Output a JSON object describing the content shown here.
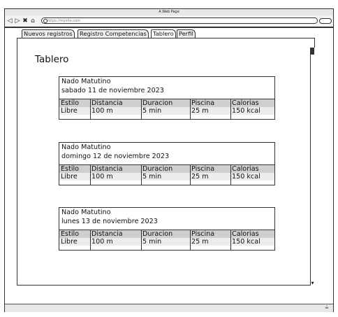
{
  "browser": {
    "window_title": "A Web Page",
    "url": "https://mysite.com"
  },
  "tabs": [
    {
      "label": "Nuevos registros"
    },
    {
      "label": "Registro Competencias"
    },
    {
      "label": "Tablero"
    },
    {
      "label": "Perfil"
    }
  ],
  "page": {
    "title": "Tablero"
  },
  "table_headers": [
    "Estilo",
    "Distancia",
    "Duracion",
    "Piscina",
    "Calorias"
  ],
  "cards": [
    {
      "title": "Nado Matutino",
      "date": "sabado 11 de noviembre 2023",
      "row": [
        "Libre",
        "100 m",
        "5 min",
        "25 m",
        "150 kcal"
      ]
    },
    {
      "title": "Nado Matutino",
      "date": "domingo 12 de noviembre 2023",
      "row": [
        "Libre",
        "100 m",
        "5 min",
        "25 m",
        "150 kcal"
      ]
    },
    {
      "title": "Nado Matutino",
      "date": "lunes 13 de noviembre 2023",
      "row": [
        "Libre",
        "100 m",
        "5 min",
        "25 m",
        "150 kcal"
      ]
    }
  ]
}
